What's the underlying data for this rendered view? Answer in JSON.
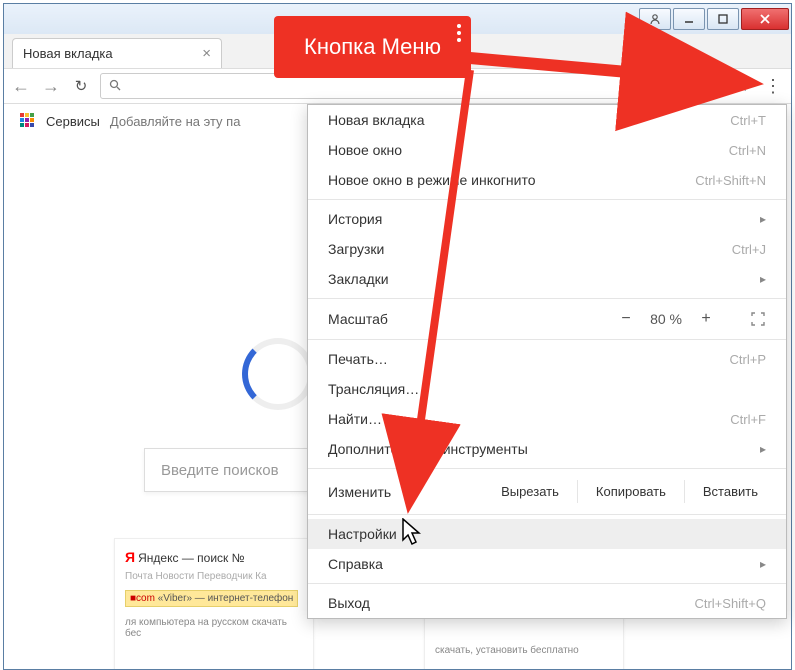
{
  "callout": {
    "label": "Кнопка Меню"
  },
  "window": {
    "tab_title": "Новая вкладка"
  },
  "toolbar": {
    "search_placeholder": ""
  },
  "bookmarks": {
    "apps_label": "Сервисы",
    "hint": "Добавляйте на эту па"
  },
  "page": {
    "search_placeholder": "Введите поисков",
    "card1_title": "Яндекс — поиск №",
    "card1_links": "Почта   Новости   Переводчик   Ка",
    "card1_viber": "«Viber» — интернет-телефон",
    "card1_bottom": "ля компьютера на русском скачать бес"
  },
  "menu": {
    "new_tab": "Новая вкладка",
    "new_tab_sc": "Ctrl+T",
    "new_window": "Новое окно",
    "new_window_sc": "Ctrl+N",
    "incognito": "Новое окно в режиме инкогнито",
    "incognito_sc": "Ctrl+Shift+N",
    "history": "История",
    "downloads": "Загрузки",
    "downloads_sc": "Ctrl+J",
    "bookmarks": "Закладки",
    "zoom_label": "Масштаб",
    "zoom_value": "80 %",
    "print": "Печать…",
    "print_sc": "Ctrl+P",
    "cast": "Трансляция…",
    "find": "Найти…",
    "find_sc": "Ctrl+F",
    "more_tools": "Дополнительные инструменты",
    "edit": "Изменить",
    "cut": "Вырезать",
    "copy": "Копировать",
    "paste": "Вставить",
    "settings": "Настройки",
    "help": "Справка",
    "exit": "Выход",
    "exit_sc": "Ctrl+Shift+Q"
  }
}
